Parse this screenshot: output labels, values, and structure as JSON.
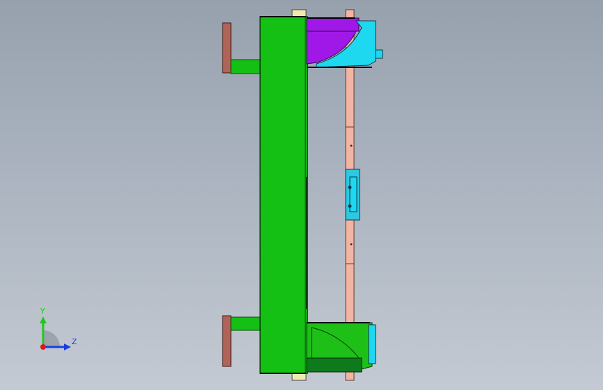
{
  "viewport": {
    "background_top": "#97a1ae",
    "background_bottom": "#c4cad3"
  },
  "model": {
    "colors": {
      "main_body": "#14c014",
      "rear_handles": "#b06458",
      "front_rail": "#f3b5a3",
      "top_fixture_purple": "#a018e8",
      "top_fixture_cyan": "#1ed8f0",
      "bottom_fixture_dark_green": "#0e7a1c",
      "bottom_fixture_green": "#1ec018",
      "center_clamp": "#2ec8e0",
      "end_caps": "#f1eab0"
    }
  },
  "triad": {
    "y_label": "Y",
    "z_label": "Z",
    "y_color": "#1ec81e",
    "z_color": "#1a3ce0",
    "origin_color": "#e01818"
  }
}
